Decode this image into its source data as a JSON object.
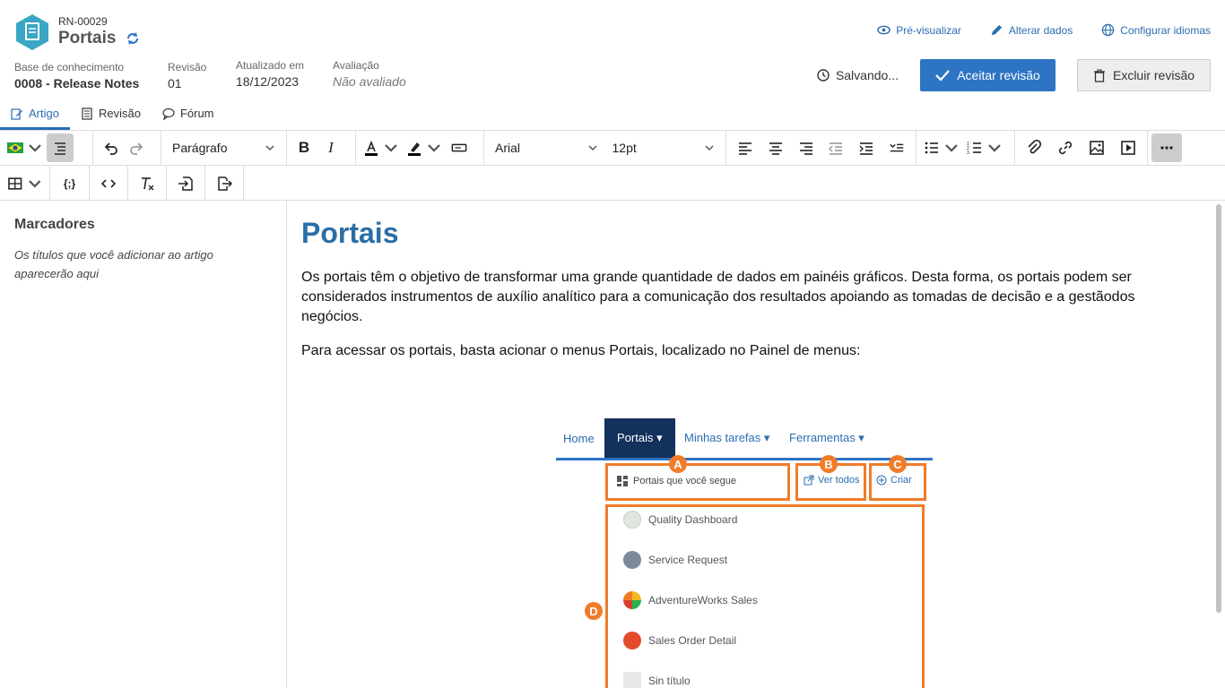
{
  "header": {
    "code": "RN-00029",
    "title": "Portais",
    "meta": [
      {
        "label": "Base de conhecimento",
        "value": "0008 - Release Notes"
      },
      {
        "label": "Revisão",
        "value": "01"
      },
      {
        "label": "Atualizado em",
        "value": "18/12/2023"
      },
      {
        "label": "Avaliação",
        "value": "Não avaliado"
      }
    ],
    "links": {
      "preview": "Pré-visualizar",
      "edit": "Alterar dados",
      "languages": "Configurar idiomas"
    },
    "saving": "Salvando...",
    "accept": "Aceitar revisão",
    "delete": "Excluir revisão"
  },
  "tabs": [
    {
      "label": "Artigo",
      "active": true
    },
    {
      "label": "Revisão",
      "active": false
    },
    {
      "label": "Fórum",
      "active": false
    }
  ],
  "toolbar": {
    "paragraph": "Parágrafo",
    "font": "Arial",
    "size": "12pt"
  },
  "side": {
    "title": "Marcadores",
    "text": "Os títulos que você adicionar ao artigo aparecerão aqui"
  },
  "content": {
    "heading": "Portais",
    "p1": "Os portais têm o objetivo de transformar uma grande quantidade de dados em painéis gráficos. Desta forma, os portais podem ser considerados instrumentos de auxílio analítico para a comunicação dos resultados apoiando as tomadas de decisão e a gestãodos negócios.",
    "p2": "Para acessar os portais, basta acionar o menus Portais, localizado no Painel de menus:"
  },
  "menu_image": {
    "nav": [
      "Home",
      "Portais ▾",
      "Minhas tarefas ▾",
      "Ferramentas ▾"
    ],
    "followed": "Portais que você segue",
    "see_all": "Ver todos",
    "create": "Criar",
    "badges": [
      "A",
      "B",
      "C",
      "D"
    ],
    "portals": [
      "Quality Dashboard",
      "Service Request",
      "AdventureWorks Sales",
      "Sales Order Detail",
      "Sin título"
    ]
  },
  "colors": {
    "accent": "#2d74c4",
    "title": "#2a6ea6",
    "highlight": "#f07c2a",
    "nav_active": "#13315c"
  }
}
